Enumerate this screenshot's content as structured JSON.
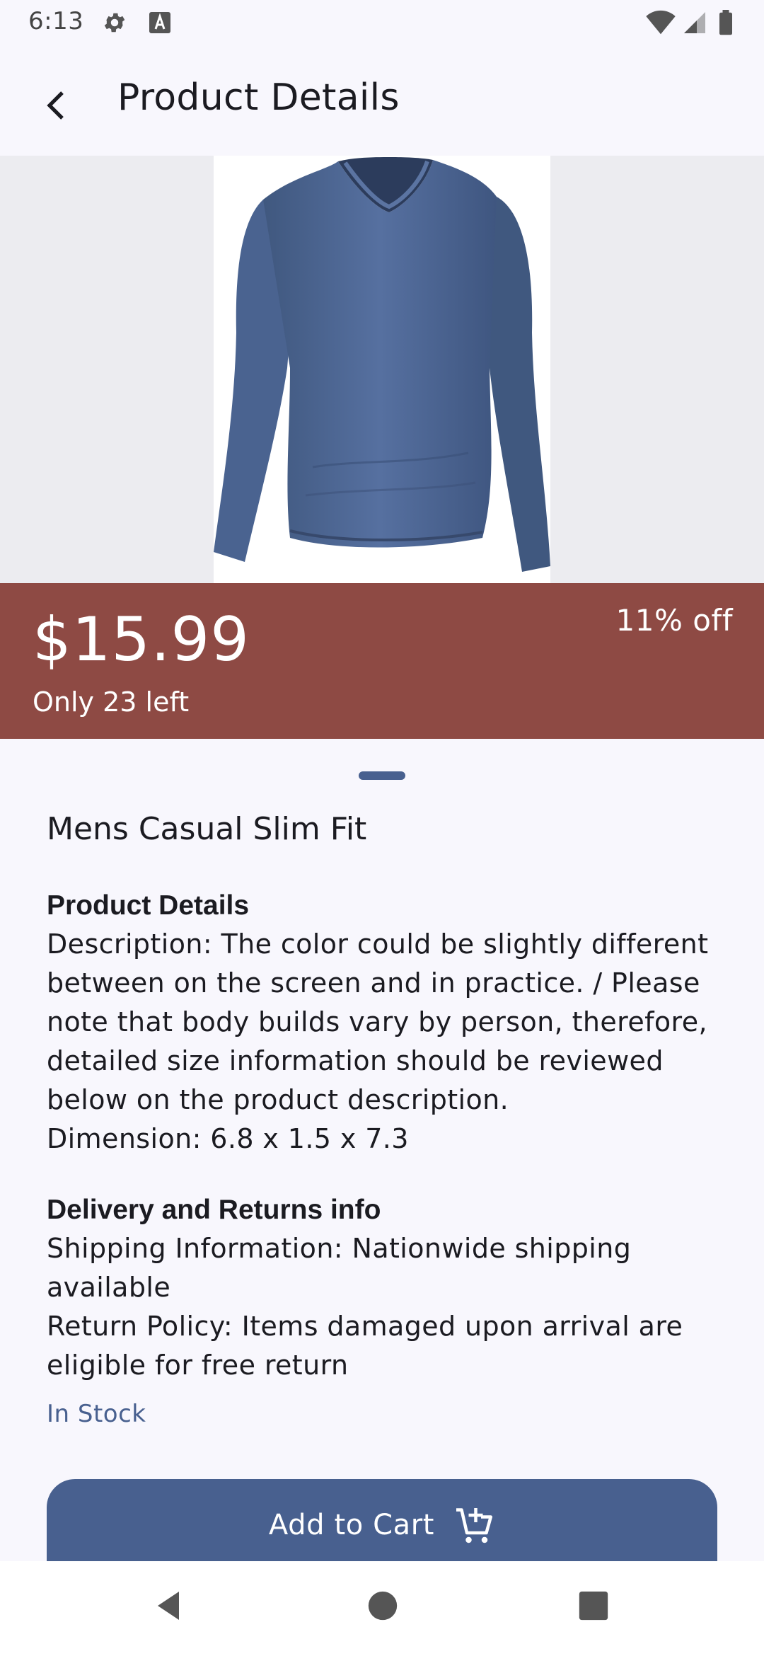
{
  "status_bar": {
    "time": "6:13",
    "icons": [
      "gear-icon",
      "keyboard-a-icon",
      "wifi-icon",
      "signal-icon",
      "battery-icon"
    ]
  },
  "app_bar": {
    "title": "Product Details",
    "back_icon": "arrow-back-icon"
  },
  "product": {
    "price": "$15.99",
    "stock_left": "Only 23 left",
    "discount": "11% off",
    "name": "Mens Casual Slim Fit",
    "details_title": "Product Details",
    "details_lines": [
      "Description: The color could be slightly different",
      "between on the screen and in practice. / Please",
      "note that body builds vary by person, therefore,",
      "detailed size information should be reviewed",
      "below on the product description.",
      "Dimension: 6.8 x 1.5 x 7.3"
    ],
    "delivery_title": "Delivery and Returns info",
    "delivery_lines": [
      "Shipping Information: Nationwide shipping",
      "available",
      "Return Policy: Items damaged upon arrival are",
      "eligible for free return"
    ],
    "availability": "In Stock",
    "add_to_cart_label": "Add to Cart"
  },
  "colors": {
    "accent": "#48608f",
    "price_banner": "#8e4a44",
    "background": "#f8f7fd",
    "shirt": "#4c6690"
  },
  "nav_bar": {
    "icons": [
      "nav-back-icon",
      "nav-home-icon",
      "nav-recents-icon"
    ]
  }
}
